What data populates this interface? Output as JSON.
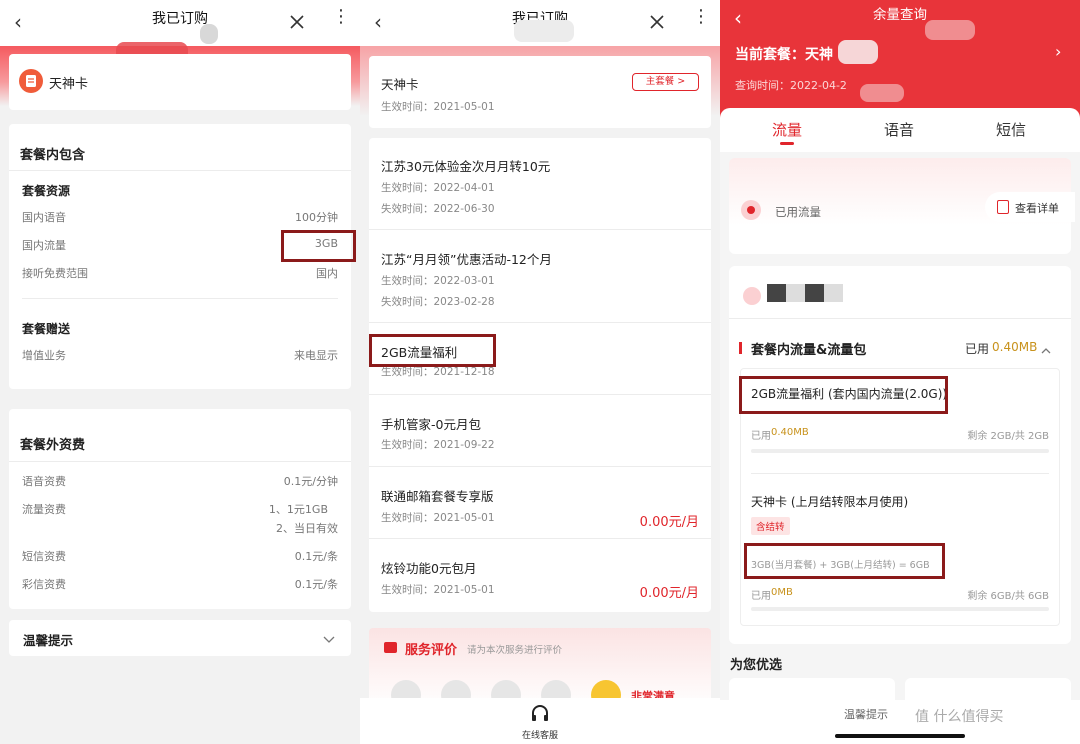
{
  "colors": {
    "accent": "#e0252b",
    "highlight_box": "#8b1a1a",
    "gold": "#c8921c"
  },
  "left": {
    "nav": {
      "title": "我已订购",
      "back_icon": "chevron-left",
      "close_icon": "close",
      "more_icon": "more-vertical"
    },
    "plan_name": "天神卡",
    "included": {
      "title": "套餐内包含",
      "resources_title": "套餐资源",
      "rows": [
        {
          "label": "国内语音",
          "value": "100分钟"
        },
        {
          "label": "国内流量",
          "value": "3GB"
        },
        {
          "label": "接听免费范围",
          "value": "国内"
        }
      ],
      "gift_title": "套餐赠送",
      "gift_rows": [
        {
          "label": "增值业务",
          "value": "来电显示"
        }
      ]
    },
    "extra": {
      "title": "套餐外资费",
      "rows": [
        {
          "label": "语音资费",
          "value": "0.1元/分钟"
        },
        {
          "label": "流量资费",
          "value": "1、1元1GB",
          "value2": "2、当日有效"
        },
        {
          "label": "短信资费",
          "value": "0.1元/条"
        },
        {
          "label": "彩信资费",
          "value": "0.1元/条"
        }
      ]
    },
    "tips": {
      "label": "温馨提示"
    }
  },
  "middle": {
    "nav": {
      "title": "我已订购"
    },
    "main": {
      "name": "天神卡",
      "date": "生效时间：2021-05-01",
      "badge": "主套餐 >"
    },
    "items": [
      {
        "name": "江苏30元体验金次月月转10元",
        "start": "生效时间：2022-04-01",
        "end": "失效时间：2022-06-30",
        "price": ""
      },
      {
        "name": "江苏“月月领”优惠活动-12个月",
        "start": "生效时间：2022-03-01",
        "end": "失效时间：2023-02-28",
        "price": ""
      },
      {
        "name": "2GB流量福利",
        "start": "生效时间：2021-12-18",
        "end": "",
        "price": ""
      },
      {
        "name": "手机管家-0元月包",
        "start": "生效时间：2021-09-22",
        "end": "",
        "price": ""
      },
      {
        "name": "联通邮箱套餐专享版",
        "start": "生效时间：2021-05-01",
        "end": "",
        "price": "0.00元/月"
      },
      {
        "name": "炫铃功能0元包月",
        "start": "生效时间：2021-05-01",
        "end": "",
        "price": "0.00元/月"
      }
    ],
    "rating": {
      "title": "服务评价",
      "hint": "请为本次服务进行评价",
      "best": "非常满意"
    },
    "service": {
      "label": "在线客服"
    }
  },
  "right": {
    "nav": {
      "title": "余量查询"
    },
    "plan_label": "当前套餐：天神",
    "query_time": "查询时间：2022-04-2",
    "tabs": [
      "流量",
      "语音",
      "短信"
    ],
    "used_flow": "已用流量",
    "detail_btn": "查看详单",
    "section": {
      "title": "套餐内流量&流量包",
      "used_label": "已用",
      "used_value": "0.40MB"
    },
    "pack1": {
      "name": "2GB流量福利 (套内国内流量(2.0G))",
      "used_label": "已用",
      "used_value": "0.40MB",
      "remain": "剩余 2GB/共 2GB",
      "progress": 0.0002
    },
    "pack2": {
      "name": "天神卡 (上月结转限本月使用)",
      "tag": "含结转",
      "formula": "3GB(当月套餐) + 3GB(上月结转) = 6GB",
      "used_label": "已用",
      "used_value": "0MB",
      "remain": "剩余 6GB/共 6GB",
      "progress": 0
    },
    "recommend": "为您优选",
    "footer_tips": "温馨提示",
    "watermark": "值 什么值得买"
  }
}
